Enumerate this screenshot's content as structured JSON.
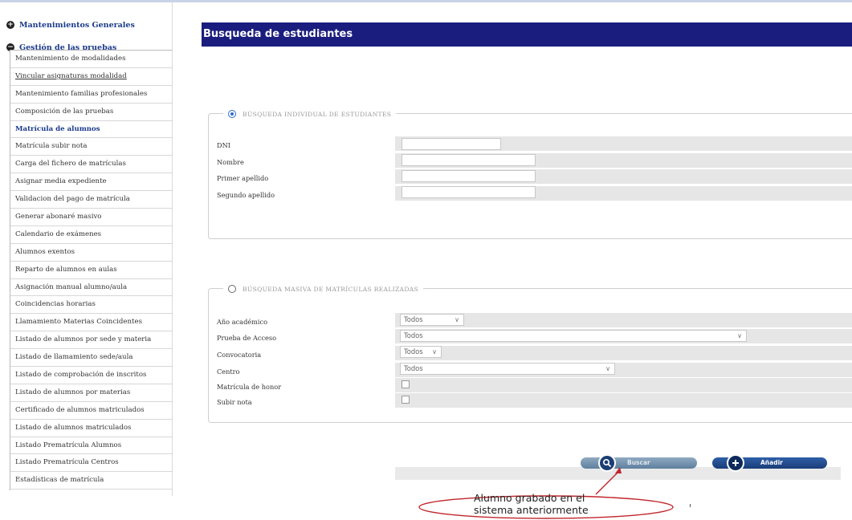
{
  "sidebar": {
    "sections": [
      {
        "label": "Mantenimientos Generales",
        "icon": "plus-circle-icon"
      },
      {
        "label": "Gestión de las pruebas",
        "icon": "minus-circle-icon"
      }
    ],
    "items": [
      {
        "label": "Mantenimiento de modalidades"
      },
      {
        "label": "Vincular asignaturas modalidad"
      },
      {
        "label": "Mantenimiento familias profesionales"
      },
      {
        "label": "Composición de las pruebas"
      },
      {
        "label": "Matrícula de alumnos"
      },
      {
        "label": "Matrícula subir nota"
      },
      {
        "label": "Carga del fichero de matrículas"
      },
      {
        "label": "Asignar media expediente"
      },
      {
        "label": "Validacion del pago de matrícula"
      },
      {
        "label": "Generar abonaré masivo"
      },
      {
        "label": "Calendario de exámenes"
      },
      {
        "label": "Alumnos exentos"
      },
      {
        "label": "Reparto de alumnos en aulas"
      },
      {
        "label": "Asignación manual alumno/aula"
      },
      {
        "label": "Coincidencias horarias"
      },
      {
        "label": "Llamamiento Materias Coincidentes"
      },
      {
        "label": "Listado de alumnos por sede y materia"
      },
      {
        "label": "Listado de llamamiento sede/aula"
      },
      {
        "label": "Listado de comprobación de inscritos"
      },
      {
        "label": "Listado de alumnos por materias"
      },
      {
        "label": "Certificado de alumnos matriculados"
      },
      {
        "label": "Listado de alumnos matriculados"
      },
      {
        "label": "Listado Prematrícula Alumnos"
      },
      {
        "label": "Listado Prematrícula Centros"
      },
      {
        "label": "Estadísticas de matrícula"
      }
    ]
  },
  "header": {
    "title": "Busqueda de estudiantes"
  },
  "individual": {
    "legend": "BÚSQUEDA INDIVIDUAL DE ESTUDIANTES",
    "selected": true,
    "fields": {
      "dni": {
        "label": "DNI",
        "value": ""
      },
      "nombre": {
        "label": "Nombre",
        "value": ""
      },
      "primer_apellido": {
        "label": "Primer apellido",
        "value": ""
      },
      "segundo_apellido": {
        "label": "Segundo apellido",
        "value": ""
      }
    }
  },
  "masiva": {
    "legend": "BÚSQUEDA MASIVA DE MATRÍCULAS REALIZADAS",
    "selected": false,
    "fields": {
      "anio": {
        "label": "Año académico",
        "value": "Todos"
      },
      "prueba": {
        "label": "Prueba de Acceso",
        "value": "Todos"
      },
      "convocatoria": {
        "label": "Convocatoria",
        "value": "Todos"
      },
      "centro": {
        "label": "Centro",
        "value": "Todos"
      },
      "matricula_honor": {
        "label": "Matrícula de honor",
        "checked": false
      },
      "subir_nota": {
        "label": "Subir nota",
        "checked": false
      }
    }
  },
  "buttons": {
    "buscar": {
      "label": "Buscar",
      "icon": "magnifier-icon"
    },
    "anadir": {
      "label": "Añadir",
      "icon": "plus-icon"
    }
  },
  "annotation": {
    "line1": "Alumno grabado en el",
    "line2": "sistema anteriormente",
    "color": "#c0262c"
  }
}
